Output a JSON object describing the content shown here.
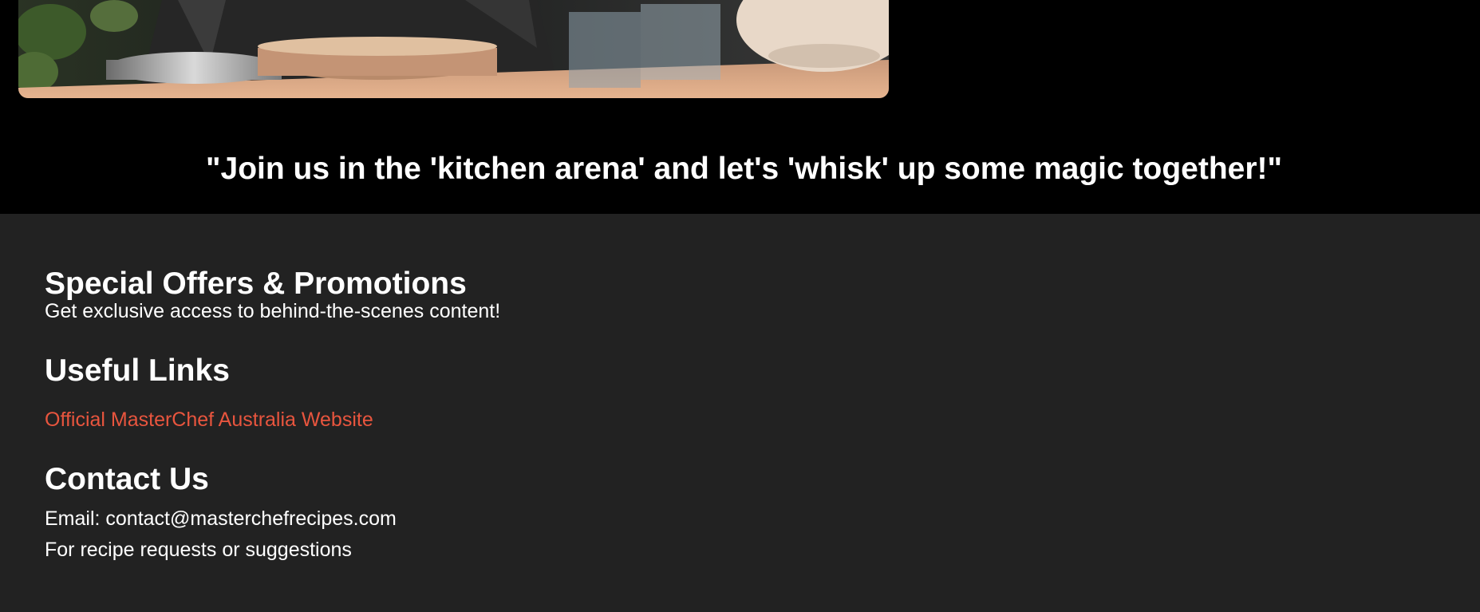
{
  "hero": {
    "image_alt": "chef at kitchen counter with pans and glasses"
  },
  "quote": {
    "text": "\"Join us in the 'kitchen arena' and let's 'whisk' up some magic together!\""
  },
  "footer": {
    "offers": {
      "heading": "Special Offers & Promotions",
      "text": "Get exclusive access to behind-the-scenes content!"
    },
    "links": {
      "heading": "Useful Links",
      "items": [
        {
          "label": "Official MasterChef Australia Website"
        }
      ]
    },
    "contact": {
      "heading": "Contact Us",
      "email": "Email: contact@masterchefrecipes.com",
      "note": "For recipe requests or suggestions"
    }
  },
  "colors": {
    "background": "#000000",
    "footer_background": "#222222",
    "link": "#e8553e",
    "text": "#ffffff"
  }
}
